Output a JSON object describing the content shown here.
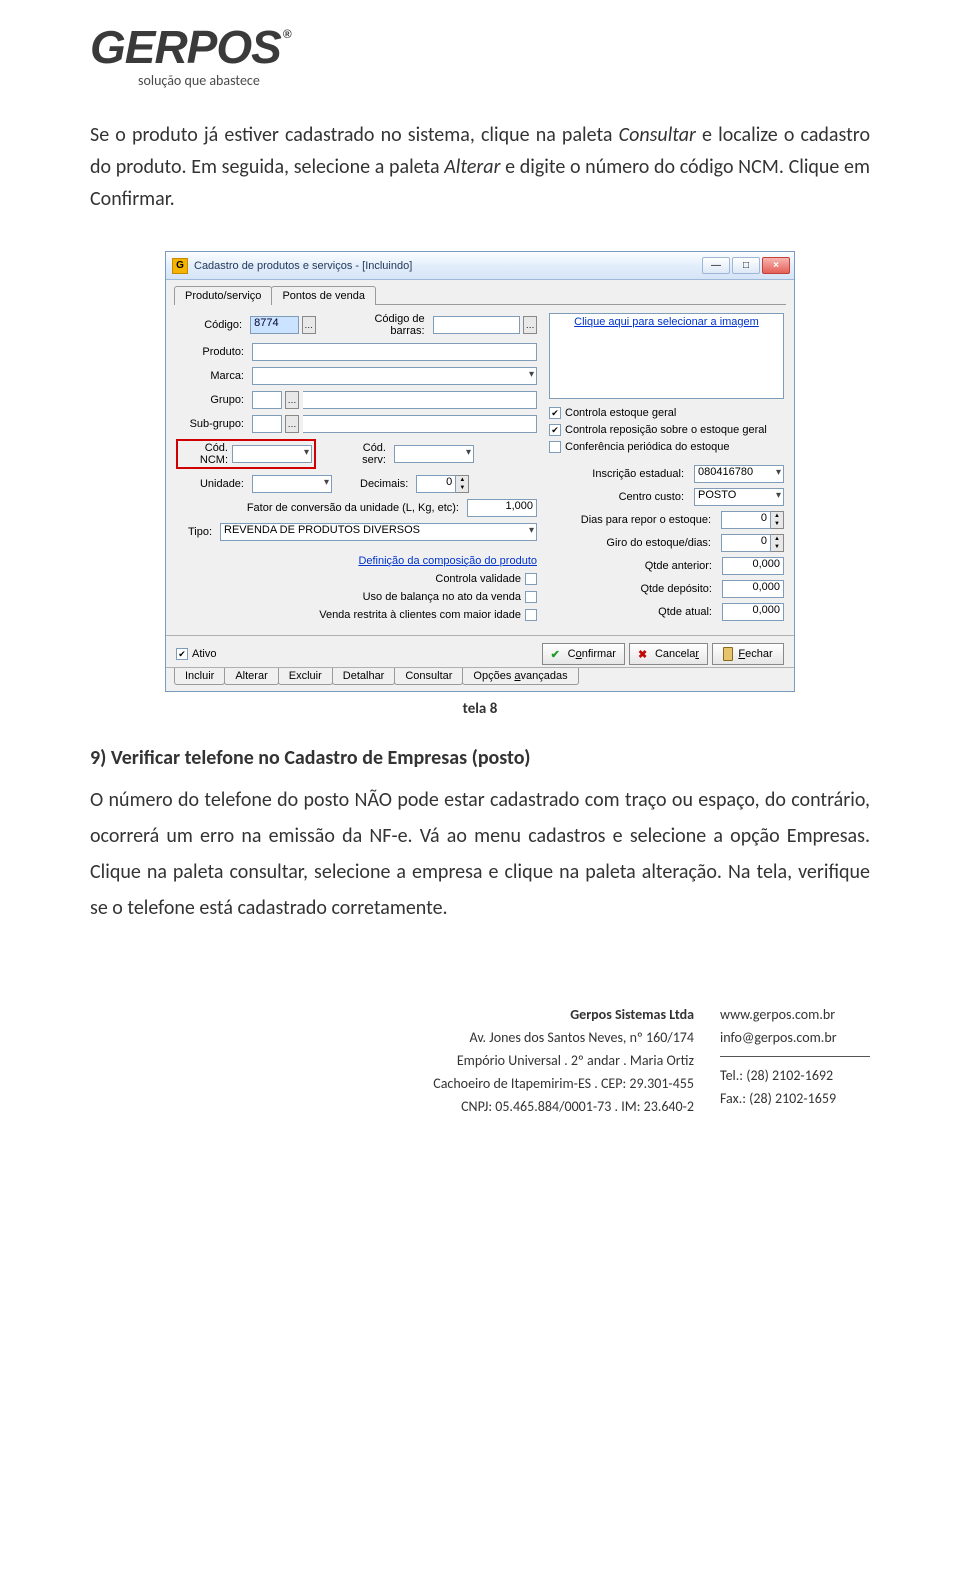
{
  "logo": {
    "brand": "GERPOS",
    "reg": "®",
    "tagline": "solução que abastece"
  },
  "intro": {
    "p1a": "Se o produto já estiver cadastrado no sistema, clique na paleta ",
    "consultar": "Consultar",
    "p1b": " e localize o cadastro do produto. Em seguida, selecione a paleta ",
    "alterar": "Alterar",
    "p1c": " e digite o número do código NCM. Clique em Confirmar."
  },
  "win": {
    "title": "Cadastro de produtos e serviços - [Incluindo]",
    "icon": "G",
    "tabs": {
      "produto": "Produto/serviço",
      "pontos": "Pontos de venda"
    },
    "labels": {
      "codigo": "Código:",
      "codbarras": "Código de barras:",
      "produto": "Produto:",
      "marca": "Marca:",
      "grupo": "Grupo:",
      "subgrupo": "Sub-grupo:",
      "codncm": "Cód. NCM:",
      "codserv": "Cód. serv:",
      "unidade": "Unidade:",
      "decimais": "Decimais:",
      "fator": "Fator de conversão da unidade (L, Kg, etc):",
      "tipo": "Tipo:",
      "defcomp": "Definição da composição do produto",
      "controla_validade": "Controla validade",
      "uso_balanca": "Uso de balança no ato da venda",
      "venda_restrita": "Venda restrita à clientes com maior idade",
      "imglink": "Clique aqui para selecionar a imagem",
      "chk_estoque": "Controla estoque geral",
      "chk_reposicao": "Controla reposição sobre o estoque geral",
      "chk_conferencia": "Conferência periódica do estoque",
      "insc_est": "Inscrição estadual:",
      "centro_custo": "Centro custo:",
      "dias_repor": "Dias para repor o estoque:",
      "giro": "Giro do estoque/dias:",
      "qtde_ant": "Qtde anterior:",
      "qtde_dep": "Qtde depósito:",
      "qtde_atual": "Qtde atual:",
      "ativo": "Ativo",
      "confirmar": "Confirmar",
      "cancelar": "Cancelar",
      "fechar": "Fechar"
    },
    "values": {
      "codigo": "8774",
      "fator": "1,000",
      "tipo": "REVENDA DE PRODUTOS DIVERSOS",
      "decimais": "0",
      "insc_est": "080416780",
      "centro_custo": "POSTO",
      "dias_repor": "0",
      "giro": "0",
      "qtde_ant": "0,000",
      "qtde_dep": "0,000",
      "qtde_atual": "0,000"
    },
    "bottomtabs": [
      "Incluir",
      "Alterar",
      "Excluir",
      "Detalhar",
      "Consultar",
      "Opções avançadas"
    ],
    "underline_chars": {
      "confirmar": "o",
      "cancelar": "r",
      "fechar": "F",
      "opcoes": "a"
    }
  },
  "caption": "tela 8",
  "section9": {
    "head": "9) Verificar telefone no Cadastro de Empresas (posto)",
    "para": "O número do telefone do posto NÃO pode estar cadastrado com traço ou espaço, do contrário, ocorrerá um erro na emissão da NF-e. Vá ao menu cadastros e selecione a  opção Empresas. Clique na paleta consultar, selecione a empresa e clique na paleta alteração. Na tela, verifique se o telefone está cadastrado corretamente."
  },
  "footer": {
    "left": [
      "Gerpos Sistemas Ltda",
      "Av. Jones dos Santos Neves, nº 160/174",
      "Empório Universal . 2º andar . Maria Ortiz",
      "Cachoeiro de Itapemirim-ES . CEP: 29.301-455",
      "CNPJ: 05.465.884/0001-73 . IM: 23.640-2"
    ],
    "right": [
      "www.gerpos.com.br",
      "info@gerpos.com.br",
      "Tel.: (28) 2102-1692",
      "Fax.: (28) 2102-1659"
    ]
  }
}
